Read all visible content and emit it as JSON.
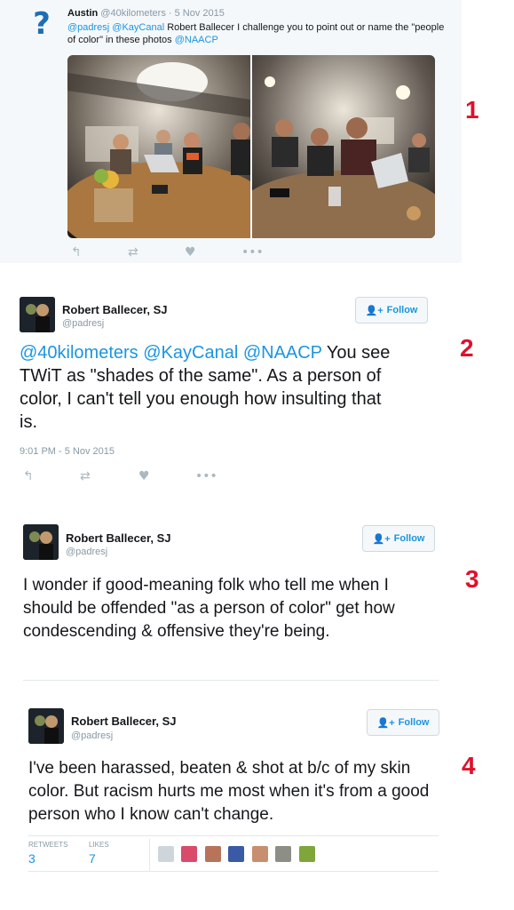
{
  "tweet1": {
    "author": "Austin",
    "handle": "@40kilometers",
    "date": "· 5 Nov 2015",
    "mentions": "@padresj @KayCanal",
    "text": "Robert Ballecer I challenge you to point out or name the \"people of color\" in these photos",
    "mention_end": "@NAACP",
    "number": "1"
  },
  "tweet2": {
    "author": "Robert Ballecer, SJ",
    "handle": "@padresj",
    "follow_label": "Follow",
    "mentions": "@40kilometers @KayCanal @NAACP",
    "text": "You see TWiT as \"shades of the same\". As a person of color, I can't tell you enough how insulting that is.",
    "timestamp": "9:01 PM - 5 Nov 2015",
    "number": "2"
  },
  "tweet3": {
    "author": "Robert Ballecer, SJ",
    "handle": "@padresj",
    "follow_label": "Follow",
    "text": "I wonder if good-meaning folk who tell me when I should be offended \"as a person of color\" get how condescending & offensive they're being.",
    "number": "3"
  },
  "tweet4": {
    "author": "Robert Ballecer, SJ",
    "handle": "@padresj",
    "follow_label": "Follow",
    "text": "I've been harassed, beaten & shot at b/c of my skin color. But racism hurts me most when it's from a good person who I know can't change.",
    "retweets_label": "RETWEETS",
    "retweets_count": "3",
    "likes_label": "LIKES",
    "likes_count": "7",
    "number": "4"
  },
  "icons": {
    "reply": "reply-icon",
    "retweet": "retweet-icon",
    "like": "heart-icon",
    "more": "more-icon",
    "follow": "add-user-icon"
  },
  "colors": {
    "link": "#1b95e0",
    "annotation": "#e0112b",
    "muted": "#8899a6"
  }
}
